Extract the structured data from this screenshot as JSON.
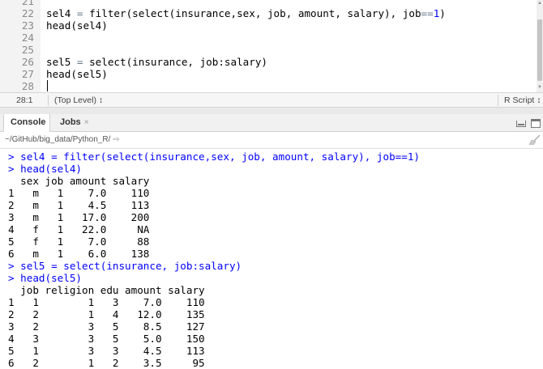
{
  "editor": {
    "lines": [
      {
        "num": "21",
        "segments": []
      },
      {
        "num": "22",
        "segments": [
          {
            "t": "sel4 "
          },
          {
            "t": "=",
            "c": "op"
          },
          {
            "t": " filter(select(insurance,sex, job, amount, salary), job"
          },
          {
            "t": "==",
            "c": "op"
          },
          {
            "t": "1",
            "c": "num"
          },
          {
            "t": ")"
          }
        ]
      },
      {
        "num": "23",
        "segments": [
          {
            "t": "head(sel4)"
          }
        ]
      },
      {
        "num": "24",
        "segments": []
      },
      {
        "num": "25",
        "segments": []
      },
      {
        "num": "26",
        "segments": [
          {
            "t": "sel5 "
          },
          {
            "t": "=",
            "c": "op"
          },
          {
            "t": " select(insurance, job:salary)"
          }
        ]
      },
      {
        "num": "27",
        "segments": [
          {
            "t": "head(sel5)"
          }
        ]
      },
      {
        "num": "28",
        "segments": []
      }
    ]
  },
  "statusbar": {
    "position": "28:1",
    "scope": "(Top Level) ↕",
    "file_type": "R Script ↕"
  },
  "console_tabs": {
    "console_label": "Console",
    "jobs_label": "Jobs",
    "jobs_close": "×"
  },
  "path": {
    "text": "~/GitHub/big_data/Python_R/",
    "arrow": "⇨"
  },
  "console": {
    "lines": [
      {
        "text": "> sel4 = filter(select(insurance,sex, job, amount, salary), job==1)",
        "cls": "cmd"
      },
      {
        "text": "> head(sel4)",
        "cls": "cmd"
      },
      {
        "text": "  sex job amount salary",
        "cls": ""
      },
      {
        "text": "1   m   1    7.0    110",
        "cls": ""
      },
      {
        "text": "2   m   1    4.5    113",
        "cls": ""
      },
      {
        "text": "3   m   1   17.0    200",
        "cls": ""
      },
      {
        "text": "4   f   1   22.0     NA",
        "cls": ""
      },
      {
        "text": "5   f   1    7.0     88",
        "cls": ""
      },
      {
        "text": "6   m   1    6.0    138",
        "cls": ""
      },
      {
        "text": "> sel5 = select(insurance, job:salary)",
        "cls": "cmd"
      },
      {
        "text": "> head(sel5)",
        "cls": "cmd"
      },
      {
        "text": "  job religion edu amount salary",
        "cls": ""
      },
      {
        "text": "1   1        1   3    7.0    110",
        "cls": ""
      },
      {
        "text": "2   2        1   4   12.0    135",
        "cls": ""
      },
      {
        "text": "3   2        3   5    8.5    127",
        "cls": ""
      },
      {
        "text": "4   3        3   5    5.0    150",
        "cls": ""
      },
      {
        "text": "5   1        3   3    4.5    113",
        "cls": ""
      },
      {
        "text": "6   2        1   2    3.5     95",
        "cls": ""
      }
    ]
  }
}
